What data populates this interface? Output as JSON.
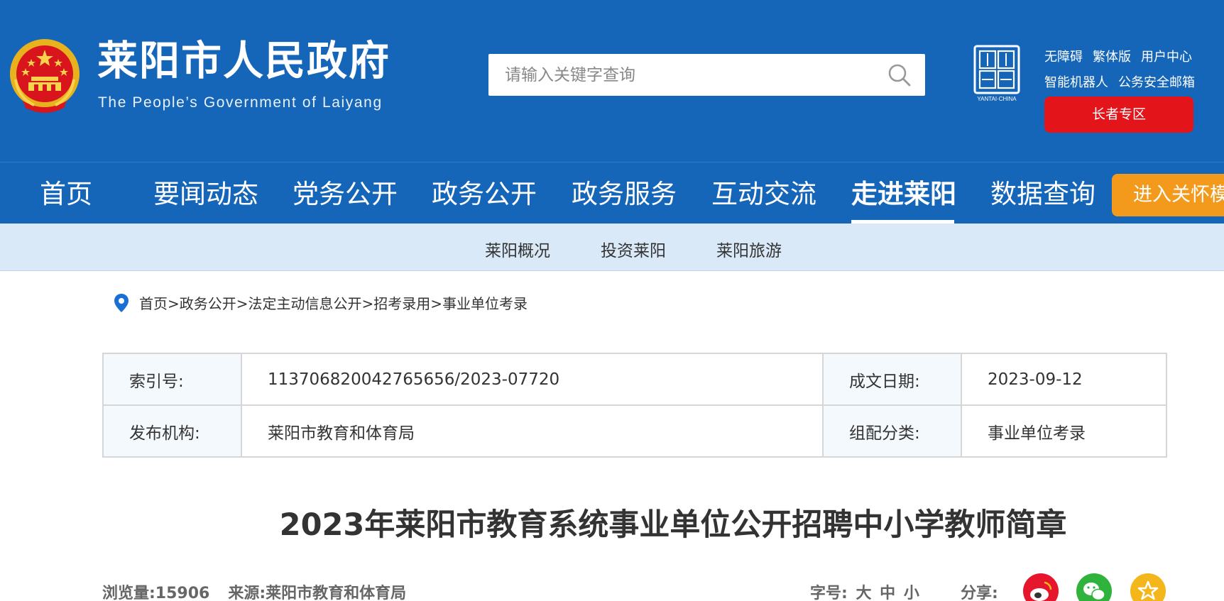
{
  "header": {
    "title": "莱阳市人民政府",
    "subtitle": "The People’s Government of Laiyang",
    "search_placeholder": "请输入关键字查询",
    "utility_links": [
      "无障碍",
      "繁体版",
      "用户中心"
    ],
    "utility_links_row2": [
      "智能机器人",
      "公务安全邮箱"
    ],
    "elder_button": "长者专区"
  },
  "nav": {
    "items": [
      "首页",
      "要闻动态",
      "党务公开",
      "政务公开",
      "政务服务",
      "互动交流",
      "走进莱阳",
      "数据查询"
    ],
    "active": "走进莱阳",
    "care_button": "进入关怀模式"
  },
  "subnav": {
    "items": [
      "莱阳概况",
      "投资莱阳",
      "莱阳旅游"
    ]
  },
  "breadcrumb": [
    "首页",
    "政务公开",
    "法定主动信息公开",
    "招考录用",
    "事业单位考录"
  ],
  "meta": {
    "index_label": "索引号:",
    "index_value": "113706820042765656/2023-07720",
    "date_label": "成文日期:",
    "date_value": "2023-09-12",
    "publisher_label": "发布机构:",
    "publisher_value": "莱阳市教育和体育局",
    "category_label": "组配分类:",
    "category_value": "事业单位考录"
  },
  "article": {
    "title": "2023年莱阳市教育系统事业单位公开招聘中小学教师简章",
    "views": "浏览量:15906",
    "source": "来源:莱阳市教育和体育局",
    "fontsize_label": "字号:",
    "fontsize_options": [
      "大",
      "中",
      "小"
    ],
    "share_label": "分享:"
  },
  "seal_text": "YANTAI·CHINA",
  "colors": {
    "header_blue": "#1565b9",
    "subnav_bg": "#d9e9f8",
    "elder_red": "#e4141b",
    "care_orange": "#f39a1c"
  }
}
